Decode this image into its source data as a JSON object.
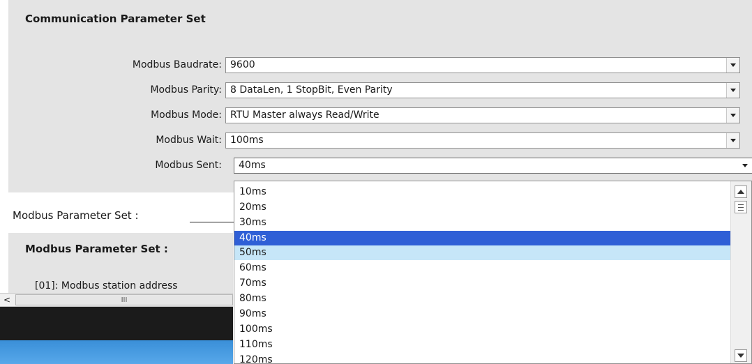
{
  "comm_panel": {
    "title": "Communication Parameter Set",
    "rows": [
      {
        "label": "Modbus Baudrate:",
        "value": "9600"
      },
      {
        "label": "Modbus Parity:",
        "value": "8 DataLen, 1 StopBit, Even Parity"
      },
      {
        "label": "Modbus Mode:",
        "value": "RTU Master always Read/Write"
      },
      {
        "label": "Modbus Wait:",
        "value": "100ms"
      },
      {
        "label": "Modbus Sent:",
        "value": "40ms"
      }
    ]
  },
  "modbus_header": {
    "label": "Modbus Parameter Set :"
  },
  "modbus_panel": {
    "title": "Modbus Parameter Set :",
    "item_partial": "[01]: Modbus  station address"
  },
  "hscroll": {
    "grip": "III",
    "left_arrow": "<"
  },
  "dropdown": {
    "options": [
      "10ms",
      "20ms",
      "30ms",
      "40ms",
      "50ms",
      "60ms",
      "70ms",
      "80ms",
      "90ms",
      "100ms",
      "110ms",
      "120ms"
    ],
    "selected": "40ms",
    "hovered": "50ms"
  },
  "colors": {
    "panel_bg": "#e4e4e4",
    "selected_bg": "#2f5fd6",
    "hover_bg": "#c6e6f8",
    "dark_strip": "#1b1b1b",
    "blue_strip": "#3a8fd8"
  }
}
